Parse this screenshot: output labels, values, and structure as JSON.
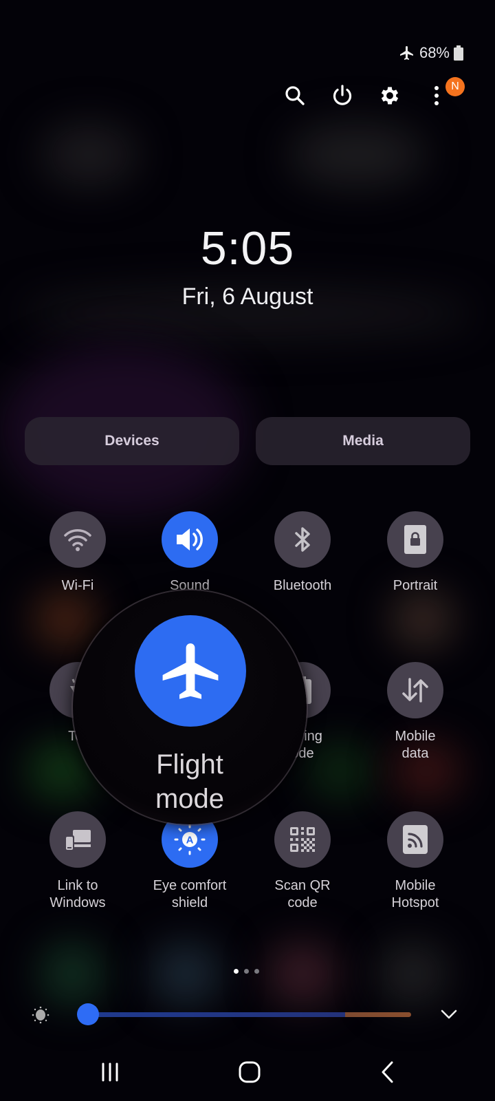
{
  "status_bar": {
    "airplane_icon": "airplane-icon",
    "battery_percent": "68%",
    "battery_icon": "battery-icon"
  },
  "header": {
    "search_icon": "search-icon",
    "power_icon": "power-icon",
    "settings_icon": "gear-icon",
    "more_icon": "more-vert-icon",
    "notification_badge": "N",
    "badge_color": "#f5731e"
  },
  "clock": {
    "time": "5:05",
    "date": "Fri, 6 August"
  },
  "panels": {
    "devices_label": "Devices",
    "media_label": "Media"
  },
  "quick_tiles": [
    {
      "label": "Wi-Fi",
      "icon": "wifi-icon",
      "active": false
    },
    {
      "label": "Sound",
      "icon": "sound-icon",
      "active": true
    },
    {
      "label": "Bluetooth",
      "icon": "bluetooth-icon",
      "active": false
    },
    {
      "label": "Portrait",
      "icon": "portrait-lock-icon",
      "active": false
    },
    {
      "label": "Torch",
      "visible_label": "Tor",
      "icon": "torch-icon",
      "active": false
    },
    {
      "label": "Flight mode",
      "icon": "airplane-icon",
      "active": true
    },
    {
      "label": "Power saving mode",
      "visible_label_line1": "saving",
      "visible_label_line2": "ode",
      "icon": "power-saving-icon",
      "active": false
    },
    {
      "label": "Mobile data",
      "line1": "Mobile",
      "line2": "data",
      "icon": "mobile-data-icon",
      "active": false
    },
    {
      "label": "Link to Windows",
      "line1": "Link to",
      "line2": "Windows",
      "icon": "link-windows-icon",
      "active": false
    },
    {
      "label": "Eye comfort shield",
      "line1": "Eye comfort",
      "line2": "shield",
      "icon": "eye-comfort-icon",
      "active": true
    },
    {
      "label": "Scan QR code",
      "line1": "Scan QR",
      "line2": "code",
      "icon": "qr-code-icon",
      "active": false
    },
    {
      "label": "Mobile Hotspot",
      "line1": "Mobile",
      "line2": "Hotspot",
      "icon": "hotspot-icon",
      "active": false
    }
  ],
  "magnifier": {
    "label_line1": "Flight",
    "label_line2": "mode",
    "icon": "airplane-icon"
  },
  "pager": {
    "pages": 3,
    "current": 1
  },
  "brightness": {
    "value_fraction": 0.02,
    "icon": "brightness-icon",
    "expand_icon": "chevron-down-icon"
  },
  "nav_bar": {
    "recents": "recents-icon",
    "home": "home-icon",
    "back": "back-icon"
  },
  "colors": {
    "accent": "#2d6cf2",
    "tile_off": "#47414e"
  }
}
